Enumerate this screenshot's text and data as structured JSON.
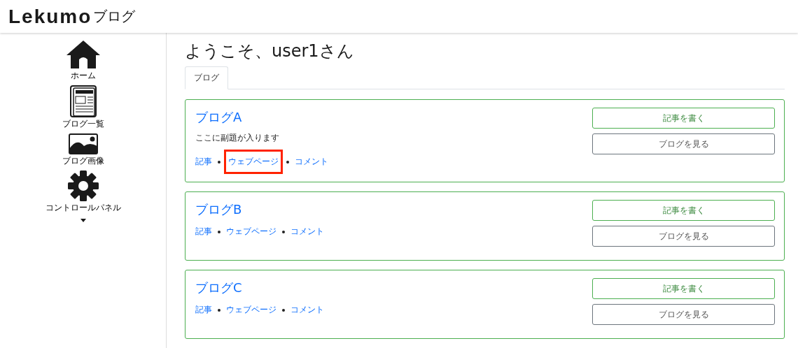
{
  "header": {
    "logo": "Lekumo",
    "logo_suffix": "ブログ"
  },
  "sidebar": {
    "items": [
      {
        "kind": "home",
        "label": "ホーム"
      },
      {
        "kind": "list",
        "label": "ブログ一覧"
      },
      {
        "kind": "image",
        "label": "ブログ画像"
      },
      {
        "kind": "settings",
        "label": "コントロールパネル",
        "expandable": true
      }
    ]
  },
  "main": {
    "title": "ようこそ、user1さん",
    "tabs": [
      {
        "label": "ブログ",
        "selected": true
      }
    ],
    "blogs": [
      {
        "name": "ブログA",
        "subtitle": "ここに副題が入ります",
        "links": [
          {
            "label": "記事",
            "highlighted": false
          },
          {
            "label": "ウェブページ",
            "highlighted": true
          },
          {
            "label": "コメント",
            "highlighted": false
          }
        ],
        "buttons": [
          {
            "kind": "primary",
            "label": "記事を書く"
          },
          {
            "kind": "secondary",
            "label": "ブログを見る"
          }
        ]
      },
      {
        "name": "ブログB",
        "links": [
          {
            "label": "記事",
            "highlighted": false
          },
          {
            "label": "ウェブページ",
            "highlighted": false
          },
          {
            "label": "コメント",
            "highlighted": false
          }
        ],
        "buttons": [
          {
            "kind": "primary",
            "label": "記事を書く"
          },
          {
            "kind": "secondary",
            "label": "ブログを見る"
          }
        ]
      },
      {
        "name": "ブログC",
        "links": [
          {
            "label": "記事",
            "highlighted": false
          },
          {
            "label": "ウェブページ",
            "highlighted": false
          },
          {
            "label": "コメント",
            "highlighted": false
          }
        ],
        "buttons": [
          {
            "kind": "primary",
            "label": "記事を書く"
          },
          {
            "kind": "secondary",
            "label": "ブログを見る"
          }
        ]
      }
    ]
  }
}
